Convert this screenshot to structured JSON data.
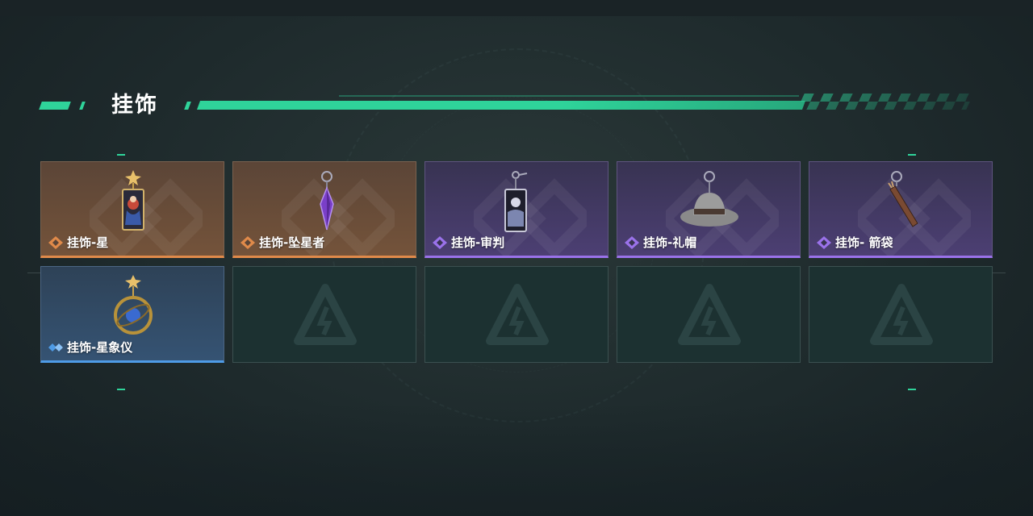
{
  "header": {
    "title": "挂饰"
  },
  "theme": {
    "accent": "#2fd39a",
    "rarity_colors": {
      "orange": "#e08a4a",
      "purple": "#9a72ea",
      "blue": "#4e9be6"
    }
  },
  "grid": {
    "rows": [
      [
        {
          "label": "挂饰-星",
          "rarity": "orange",
          "icon": "tarot-card-star-charm-icon"
        },
        {
          "label": "挂饰-坠星者",
          "rarity": "orange",
          "icon": "purple-crystal-pendant-icon"
        },
        {
          "label": "挂饰-审判",
          "rarity": "purple",
          "icon": "tarot-card-judgement-charm-icon"
        },
        {
          "label": "挂饰-礼帽",
          "rarity": "purple",
          "icon": "fedora-hat-charm-icon"
        },
        {
          "label": "挂饰- 箭袋",
          "rarity": "purple",
          "icon": "quiver-charm-icon"
        }
      ],
      [
        {
          "label": "挂饰-星象仪",
          "rarity": "blue",
          "icon": "armillary-sphere-charm-icon"
        },
        {
          "empty": true,
          "icon": "empty-slot-logo-icon"
        },
        {
          "empty": true,
          "icon": "empty-slot-logo-icon"
        },
        {
          "empty": true,
          "icon": "empty-slot-logo-icon"
        },
        {
          "empty": true,
          "icon": "empty-slot-logo-icon"
        }
      ]
    ]
  }
}
